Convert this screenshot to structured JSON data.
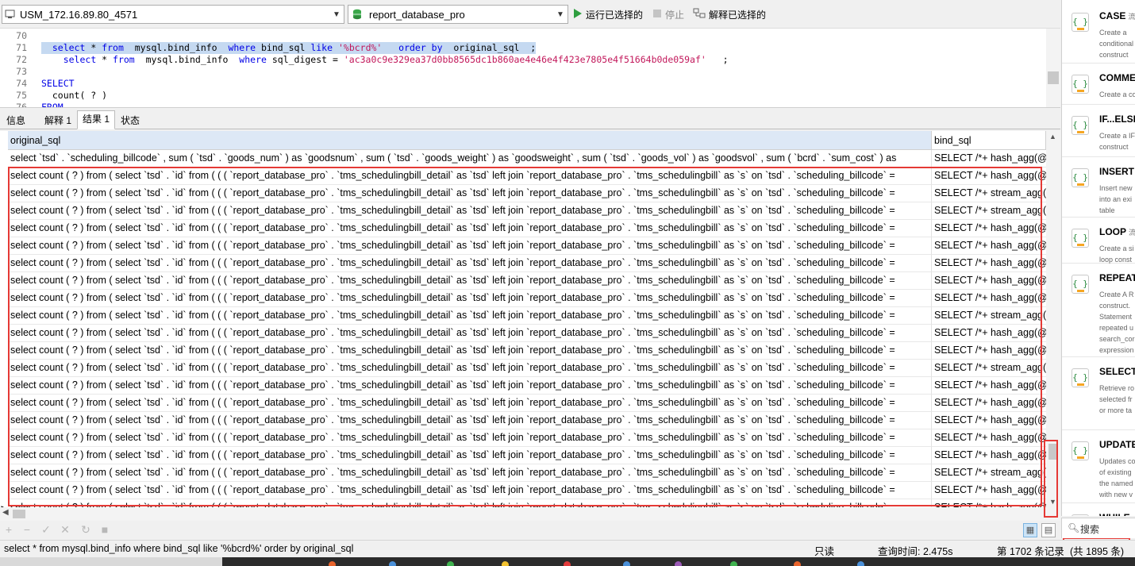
{
  "toolbar": {
    "connection": "USM_172.16.89.80_4571",
    "database": "report_database_pro",
    "run_selected": "运行已选择的",
    "stop": "停止",
    "explain_selected": "解释已选择的"
  },
  "editor": {
    "lines": [
      {
        "num": "70",
        "parts": []
      },
      {
        "num": "71",
        "highlight": true,
        "parts": [
          {
            "t": "  "
          },
          {
            "t": "select",
            "k": "kw"
          },
          {
            "t": " * "
          },
          {
            "t": "from",
            "k": "kw"
          },
          {
            "t": "  mysql.bind_info  "
          },
          {
            "t": "where",
            "k": "kw"
          },
          {
            "t": " bind_sql "
          },
          {
            "t": "like",
            "k": "kw"
          },
          {
            "t": " "
          },
          {
            "t": "'%bcrd%'",
            "k": "str"
          },
          {
            "t": "   "
          },
          {
            "t": "order by",
            "k": "kw"
          },
          {
            "t": "  original_sql  ;"
          }
        ]
      },
      {
        "num": "72",
        "parts": [
          {
            "t": "    "
          },
          {
            "t": "select",
            "k": "kw"
          },
          {
            "t": " * "
          },
          {
            "t": "from",
            "k": "kw"
          },
          {
            "t": "  mysql.bind_info  "
          },
          {
            "t": "where",
            "k": "kw"
          },
          {
            "t": " sql_digest = "
          },
          {
            "t": "'ac3a0c9e329ea37d0bb8565dc1b860ae4e46e4f423e7805e4f51664b0de059af'",
            "k": "str"
          },
          {
            "t": "   ;"
          }
        ]
      },
      {
        "num": "73",
        "parts": []
      },
      {
        "num": "74",
        "parts": [
          {
            "t": "SELECT",
            "k": "kw"
          }
        ]
      },
      {
        "num": "75",
        "parts": [
          {
            "t": "  count( ? )"
          }
        ]
      },
      {
        "num": "76",
        "parts": [
          {
            "t": "FROM",
            "k": "kw"
          }
        ]
      }
    ]
  },
  "tabs": [
    "信息",
    "解释 1",
    "结果 1",
    "状态"
  ],
  "grid": {
    "columns": [
      "original_sql",
      "bind_sql"
    ],
    "rows": [
      [
        "select `tsd` . `scheduling_billcode` , sum ( `tsd` . `goods_num` ) as `goodsnum` , sum ( `tsd` . `goods_weight` ) as `goodsweight` , sum ( `tsd` . `goods_vol` ) as `goodsvol` , sum ( `bcrd` . `sum_cost` ) as",
        "SELECT /*+ hash_agg(@"
      ],
      [
        "select count ( ? ) from ( select `tsd` . `id` from ( ( ( `report_database_pro` . `tms_schedulingbill_detail` as `tsd` left join `report_database_pro` . `tms_schedulingbill` as `s` on `tsd` . `scheduling_billcode` =",
        "SELECT /*+ hash_agg(@"
      ],
      [
        "select count ( ? ) from ( select `tsd` . `id` from ( ( ( `report_database_pro` . `tms_schedulingbill_detail` as `tsd` left join `report_database_pro` . `tms_schedulingbill` as `s` on `tsd` . `scheduling_billcode` =",
        "SELECT /*+ stream_agg("
      ],
      [
        "select count ( ? ) from ( select `tsd` . `id` from ( ( ( `report_database_pro` . `tms_schedulingbill_detail` as `tsd` left join `report_database_pro` . `tms_schedulingbill` as `s` on `tsd` . `scheduling_billcode` =",
        "SELECT /*+ stream_agg("
      ],
      [
        "select count ( ? ) from ( select `tsd` . `id` from ( ( ( `report_database_pro` . `tms_schedulingbill_detail` as `tsd` left join `report_database_pro` . `tms_schedulingbill` as `s` on `tsd` . `scheduling_billcode` =",
        "SELECT /*+ hash_agg(@"
      ],
      [
        "select count ( ? ) from ( select `tsd` . `id` from ( ( ( `report_database_pro` . `tms_schedulingbill_detail` as `tsd` left join `report_database_pro` . `tms_schedulingbill` as `s` on `tsd` . `scheduling_billcode` =",
        "SELECT /*+ hash_agg(@"
      ],
      [
        "select count ( ? ) from ( select `tsd` . `id` from ( ( ( `report_database_pro` . `tms_schedulingbill_detail` as `tsd` left join `report_database_pro` . `tms_schedulingbill` as `s` on `tsd` . `scheduling_billcode` =",
        "SELECT /*+ hash_agg(@"
      ],
      [
        "select count ( ? ) from ( select `tsd` . `id` from ( ( ( `report_database_pro` . `tms_schedulingbill_detail` as `tsd` left join `report_database_pro` . `tms_schedulingbill` as `s` on `tsd` . `scheduling_billcode` =",
        "SELECT /*+ hash_agg(@"
      ],
      [
        "select count ( ? ) from ( select `tsd` . `id` from ( ( ( `report_database_pro` . `tms_schedulingbill_detail` as `tsd` left join `report_database_pro` . `tms_schedulingbill` as `s` on `tsd` . `scheduling_billcode` =",
        "SELECT /*+ hash_agg(@"
      ],
      [
        "select count ( ? ) from ( select `tsd` . `id` from ( ( ( `report_database_pro` . `tms_schedulingbill_detail` as `tsd` left join `report_database_pro` . `tms_schedulingbill` as `s` on `tsd` . `scheduling_billcode` =",
        "SELECT /*+ stream_agg("
      ],
      [
        "select count ( ? ) from ( select `tsd` . `id` from ( ( ( `report_database_pro` . `tms_schedulingbill_detail` as `tsd` left join `report_database_pro` . `tms_schedulingbill` as `s` on `tsd` . `scheduling_billcode` =",
        "SELECT /*+ hash_agg(@"
      ],
      [
        "select count ( ? ) from ( select `tsd` . `id` from ( ( ( `report_database_pro` . `tms_schedulingbill_detail` as `tsd` left join `report_database_pro` . `tms_schedulingbill` as `s` on `tsd` . `scheduling_billcode` =",
        "SELECT /*+ hash_agg(@"
      ],
      [
        "select count ( ? ) from ( select `tsd` . `id` from ( ( ( `report_database_pro` . `tms_schedulingbill_detail` as `tsd` left join `report_database_pro` . `tms_schedulingbill` as `s` on `tsd` . `scheduling_billcode` =",
        "SELECT /*+ stream_agg("
      ],
      [
        "select count ( ? ) from ( select `tsd` . `id` from ( ( ( `report_database_pro` . `tms_schedulingbill_detail` as `tsd` left join `report_database_pro` . `tms_schedulingbill` as `s` on `tsd` . `scheduling_billcode` =",
        "SELECT /*+ hash_agg(@"
      ],
      [
        "select count ( ? ) from ( select `tsd` . `id` from ( ( ( `report_database_pro` . `tms_schedulingbill_detail` as `tsd` left join `report_database_pro` . `tms_schedulingbill` as `s` on `tsd` . `scheduling_billcode` =",
        "SELECT /*+ hash_agg(@"
      ],
      [
        "select count ( ? ) from ( select `tsd` . `id` from ( ( ( `report_database_pro` . `tms_schedulingbill_detail` as `tsd` left join `report_database_pro` . `tms_schedulingbill` as `s` on `tsd` . `scheduling_billcode` =",
        "SELECT /*+ hash_agg(@"
      ],
      [
        "select count ( ? ) from ( select `tsd` . `id` from ( ( ( `report_database_pro` . `tms_schedulingbill_detail` as `tsd` left join `report_database_pro` . `tms_schedulingbill` as `s` on `tsd` . `scheduling_billcode` =",
        "SELECT /*+ hash_agg(@"
      ],
      [
        "select count ( ? ) from ( select `tsd` . `id` from ( ( ( `report_database_pro` . `tms_schedulingbill_detail` as `tsd` left join `report_database_pro` . `tms_schedulingbill` as `s` on `tsd` . `scheduling_billcode` =",
        "SELECT /*+ hash_agg(@"
      ],
      [
        "select count ( ? ) from ( select `tsd` . `id` from ( ( ( `report_database_pro` . `tms_schedulingbill_detail` as `tsd` left join `report_database_pro` . `tms_schedulingbill` as `s` on `tsd` . `scheduling_billcode` =",
        "SELECT /*+ stream_agg("
      ],
      [
        "select count ( ? ) from ( select `tsd` . `id` from ( ( ( `report_database_pro` . `tms_schedulingbill_detail` as `tsd` left join `report_database_pro` . `tms_schedulingbill` as `s` on `tsd` . `scheduling_billcode` =",
        "SELECT /*+ hash_agg(@"
      ],
      [
        "select count ( ? ) from ( select `tsd` . `id` from ( ( ( `report_database_pro` . `tms_schedulingbill_detail` as `tsd` left join `report_database_pro` . `tms_schedulingbill` as `s` on `tsd` . `scheduling_billcode` =",
        "SELECT /*+ hash_agg(@"
      ]
    ],
    "current_row_marker": "▶"
  },
  "statusbar": {
    "query": "select * from  mysql.bind_info  where bind_sql like '%bcrd%'   order by  original_sql",
    "readonly": "只读",
    "query_time": "查询时间: 2.475s",
    "record": "第 1702 条记录",
    "total": "(共 1895 条)"
  },
  "snippets": {
    "search_label": "搜索",
    "items": [
      {
        "title": "CASE",
        "sub": "流程",
        "desc": [
          "Create a",
          "conditional",
          "construct"
        ]
      },
      {
        "title": "COMMENT",
        "sub": "",
        "desc": [
          "Create a comment"
        ]
      },
      {
        "title": "IF...ELSE",
        "sub": "",
        "desc": [
          "Create a IF",
          "construct"
        ]
      },
      {
        "title": "INSERT",
        "sub": "",
        "desc": [
          "Insert new",
          "into an exi",
          "table"
        ]
      },
      {
        "title": "LOOP",
        "sub": "流程",
        "desc": [
          "Create a si",
          "loop const"
        ]
      },
      {
        "title": "REPEAT",
        "sub": "",
        "desc": [
          "Create A R",
          "construct.",
          "Statement",
          "repeated u",
          "search_cor",
          "expression"
        ]
      },
      {
        "title": "SELECT",
        "sub": "",
        "desc": [
          "Retrieve ro",
          "selected fr",
          "or more ta"
        ]
      },
      {
        "title": "UPDATE",
        "sub": "",
        "desc": [
          "Updates co",
          "of existing",
          "the named",
          "with new v"
        ]
      },
      {
        "title": "WHILE",
        "sub": "",
        "desc": []
      }
    ]
  },
  "colors": {
    "run_green": "#2e9e3f",
    "highlight_red": "#e53935",
    "selection_blue": "#c5d9f1"
  }
}
